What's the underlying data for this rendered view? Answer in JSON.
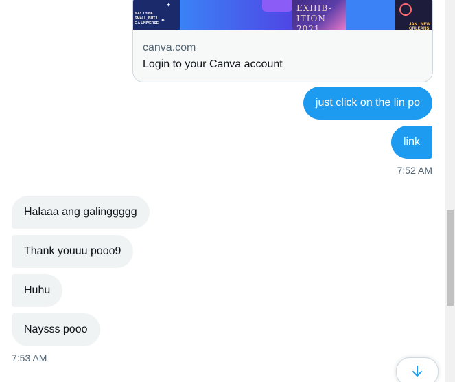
{
  "link_card": {
    "domain": "canva.com",
    "title": "Login to your Canva account",
    "image_text": {
      "tile1": "MAY THINK\nSMALL, BUT I\nE A UNIVERSE",
      "tile3": "EXHIB-\nITION\n2021",
      "tile5": "JAN | NEW ORLEANS"
    }
  },
  "sent_messages": [
    {
      "text": "just click on the lin po"
    },
    {
      "text": "link"
    }
  ],
  "sent_time": "7:52 AM",
  "received_messages": [
    {
      "text": "Halaaa ang galinggggg"
    },
    {
      "text": "Thank youuu pooo9"
    },
    {
      "text": "Huhu"
    },
    {
      "text": "Naysss pooo"
    }
  ],
  "received_time": "7:53 AM",
  "colors": {
    "accent": "#1d9bf0",
    "incoming_bubble": "#eff3f4",
    "secondary_text": "#536471"
  },
  "icons": {
    "scroll_down": "arrow-down-icon"
  }
}
